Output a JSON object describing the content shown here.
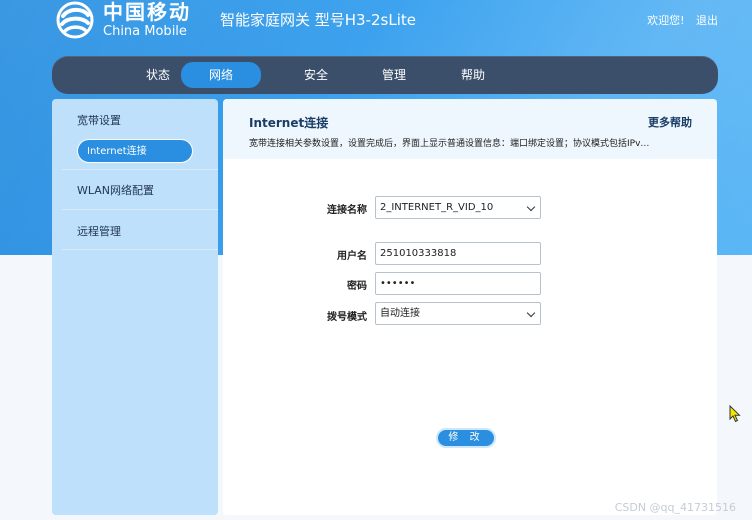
{
  "brand": {
    "name_cn": "中国移动",
    "name_en": "China Mobile",
    "color": "#2a8fe0"
  },
  "header": {
    "model_title": "智能家庭网关 型号H3-2sLite",
    "welcome": "欢迎您!",
    "logout": "退出"
  },
  "nav": {
    "items": [
      {
        "label": "状态",
        "active": false
      },
      {
        "label": "网络",
        "active": true
      },
      {
        "label": "安全",
        "active": false
      },
      {
        "label": "管理",
        "active": false
      },
      {
        "label": "帮助",
        "active": false
      }
    ]
  },
  "sidebar": {
    "groups": [
      {
        "label": "宽带设置",
        "sub_items": [
          {
            "label": "Internet连接",
            "active": true
          }
        ]
      },
      {
        "label": "WLAN网络配置"
      },
      {
        "label": "远程管理"
      }
    ]
  },
  "content": {
    "title": "Internet连接",
    "help_link": "更多帮助",
    "description": "宽带连接相关参数设置，设置完成后，界面上显示普通设置信息：端口绑定设置；协议模式包括IPv…"
  },
  "form": {
    "connection_name_label": "连接名称",
    "connection_name_value": "2_INTERNET_R_VID_10",
    "username_label": "用户名",
    "username_value": "251010333818",
    "password_label": "密码",
    "password_value": "••••••",
    "dial_mode_label": "拨号模式",
    "dial_mode_value": "自动连接",
    "submit_label": "修 改"
  },
  "watermark": "CSDN @qq_41731516"
}
